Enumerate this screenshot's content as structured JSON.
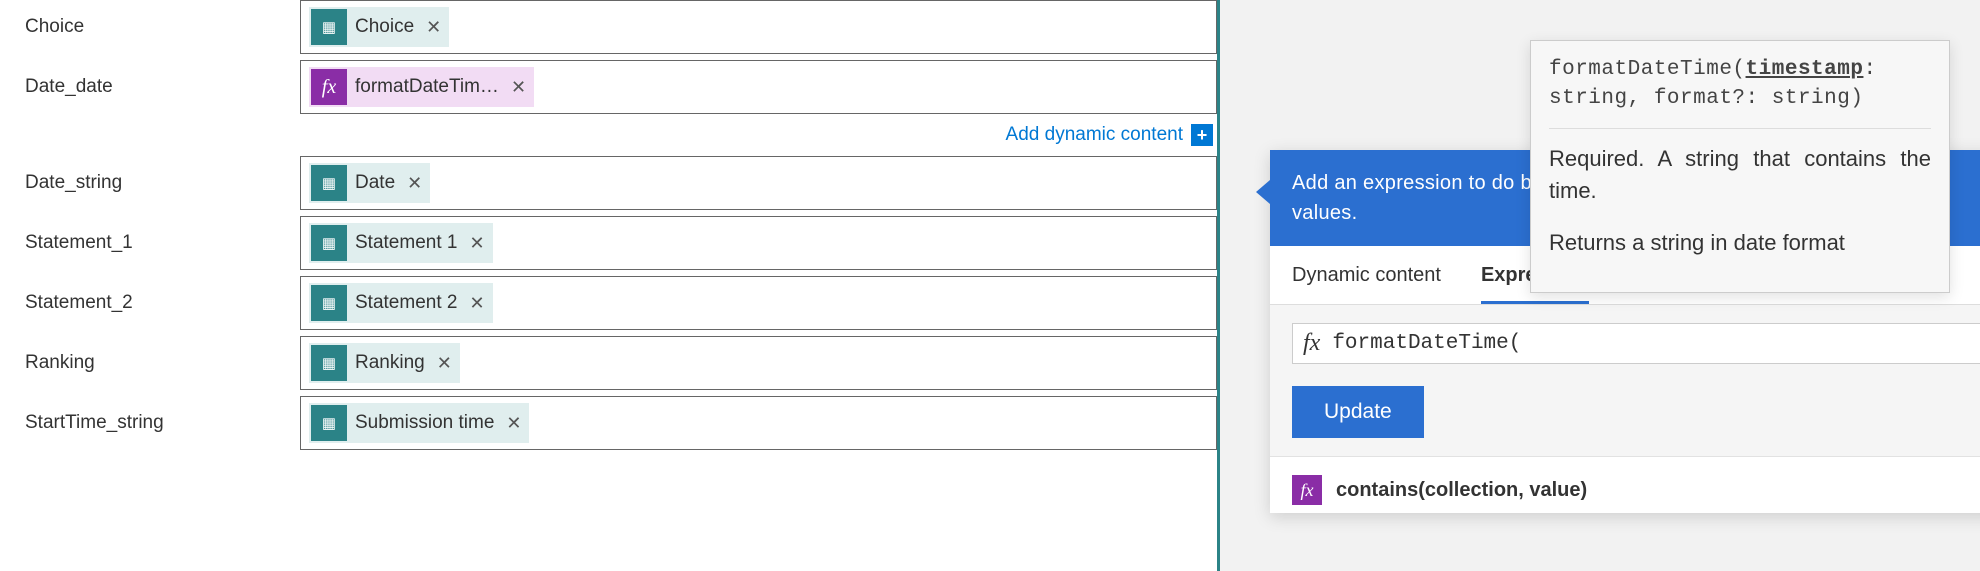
{
  "fields": [
    {
      "label": "Choice",
      "token": {
        "type": "forms",
        "text": "Choice"
      }
    },
    {
      "label": "Date_date",
      "token": {
        "type": "fx",
        "text": "formatDateTim…"
      },
      "show_addlink": true
    },
    {
      "label": "Date_string",
      "token": {
        "type": "forms",
        "text": "Date"
      }
    },
    {
      "label": "Statement_1",
      "token": {
        "type": "forms",
        "text": "Statement 1"
      }
    },
    {
      "label": "Statement_2",
      "token": {
        "type": "forms",
        "text": "Statement 2"
      }
    },
    {
      "label": "Ranking",
      "token": {
        "type": "forms",
        "text": "Ranking"
      }
    },
    {
      "label": "StartTime_string",
      "token": {
        "type": "forms",
        "text": "Submission time"
      }
    }
  ],
  "addlink_text": "Add dynamic content",
  "flyout": {
    "header": "Add an expression to do basic things like access, convert, and compare values.",
    "tabs": {
      "dynamic": "Dynamic content",
      "expression": "Expression"
    },
    "expr_value": "formatDateTime(",
    "update_label": "Update",
    "func_signature": "contains(collection, value)"
  },
  "tooltip": {
    "signature_prefix": "formatDateTime(",
    "signature_param": "timestamp",
    "signature_suffix": ": string, format?: string)",
    "param_desc": "Required. A string that contains the time.",
    "return_desc": "Returns a string in date format"
  },
  "icons": {
    "forms_glyph": "▦",
    "fx_glyph": "fx",
    "close_glyph": "✕",
    "plus_glyph": "+"
  }
}
